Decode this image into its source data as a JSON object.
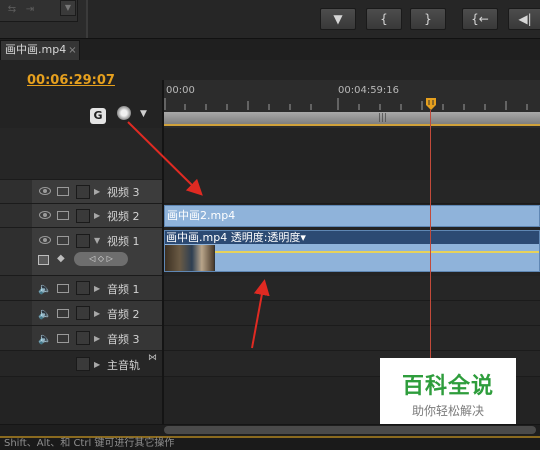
{
  "monitor_buttons": [
    {
      "label": "▼",
      "name": "add-marker-button"
    },
    {
      "label": "{",
      "name": "mark-in-button"
    },
    {
      "label": "}",
      "name": "mark-out-button"
    },
    {
      "label": "{←",
      "name": "go-to-in-button"
    },
    {
      "label": "◀|",
      "name": "step-back-button"
    }
  ],
  "sequence_tab": {
    "title": "画中画.mp4",
    "close": "×"
  },
  "timecode": "00:06:29:07",
  "ruler": {
    "start": "00:00",
    "mid": "00:04:59:16"
  },
  "tracks": {
    "video": [
      {
        "name": "视频 3"
      },
      {
        "name": "视频 2"
      },
      {
        "name": "视频 1"
      }
    ],
    "audio": [
      {
        "name": "音频 1"
      },
      {
        "name": "音频 2"
      },
      {
        "name": "音频 3"
      }
    ],
    "master": {
      "name": "主音轨"
    }
  },
  "clips": {
    "v2": "画中画2.mp4",
    "v1": "画中画.mp4  透明度:透明度▾"
  },
  "status": "Shift、Alt、和 Ctrl 键可进行其它操作",
  "watermark": {
    "title": "百科全说",
    "subtitle": "助你轻松解决"
  },
  "colors": {
    "timecode": "#e6a01e",
    "clip": "#8fb3da",
    "playhead": "#c24a3a",
    "watermark_green": "#2e9d3c"
  }
}
